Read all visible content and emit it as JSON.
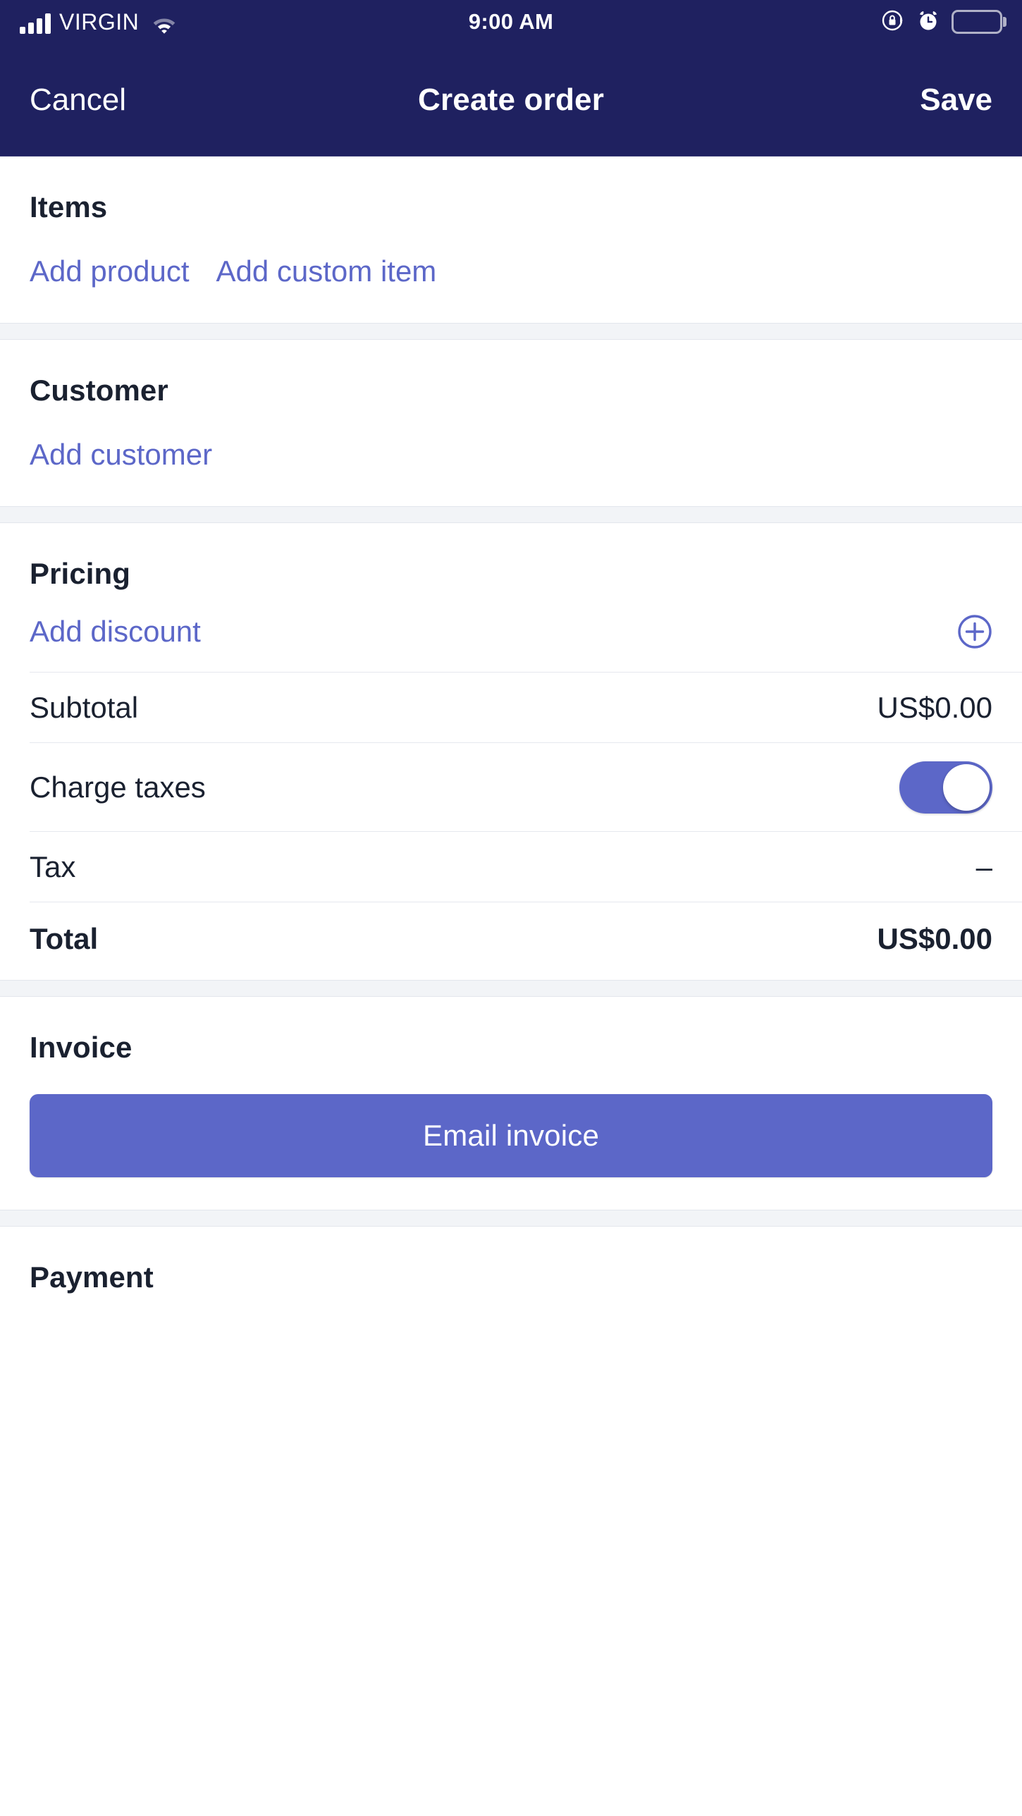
{
  "status_bar": {
    "carrier": "VIRGIN",
    "time": "9:00 AM",
    "signal_icon": "signal-bars-icon",
    "wifi_icon": "wifi-icon",
    "rotation_lock_icon": "rotation-lock-icon",
    "alarm_icon": "alarm-clock-icon",
    "battery_icon": "battery-icon"
  },
  "nav": {
    "cancel_label": "Cancel",
    "title": "Create order",
    "save_label": "Save"
  },
  "items": {
    "heading": "Items",
    "add_product_label": "Add product",
    "add_custom_item_label": "Add custom item"
  },
  "customer": {
    "heading": "Customer",
    "add_customer_label": "Add customer"
  },
  "pricing": {
    "heading": "Pricing",
    "add_discount_label": "Add discount",
    "add_discount_icon": "plus-circle-icon",
    "subtotal_label": "Subtotal",
    "subtotal_value": "US$0.00",
    "charge_taxes_label": "Charge taxes",
    "charge_taxes_on": true,
    "tax_label": "Tax",
    "tax_value": "–",
    "total_label": "Total",
    "total_value": "US$0.00"
  },
  "invoice": {
    "heading": "Invoice",
    "email_invoice_label": "Email invoice"
  },
  "payment": {
    "heading": "Payment"
  },
  "colors": {
    "navy": "#1f2160",
    "accent": "#5c67c8",
    "text": "#1a2130",
    "gap_bg": "#f2f4f7"
  }
}
